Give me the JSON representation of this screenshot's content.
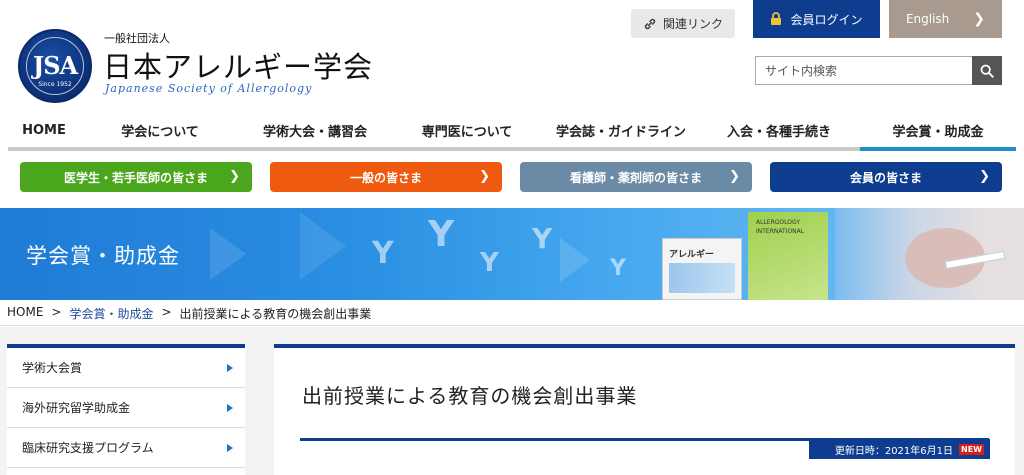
{
  "logo": {
    "emblem": "JSA",
    "since": "Since 1952",
    "org_type": "一般社団法人",
    "name_ja": "日本アレルギー学会",
    "name_en": "Japanese Society of Allergology"
  },
  "utility": {
    "links_label": "関連リンク",
    "login_label": "会員ログイン",
    "english_label": "English",
    "search_placeholder": "サイト内検索"
  },
  "nav": [
    {
      "label": "HOME",
      "active": false
    },
    {
      "label": "学会について",
      "active": false
    },
    {
      "label": "学術大会・講習会",
      "active": false
    },
    {
      "label": "専門医について",
      "active": false
    },
    {
      "label": "学会誌・ガイドライン",
      "active": false
    },
    {
      "label": "入会・各種手続き",
      "active": false
    },
    {
      "label": "学会賞・助成金",
      "active": true
    }
  ],
  "audience": [
    {
      "label": "医学生・若手医師の皆さま",
      "color": "#4aa61c"
    },
    {
      "label": "一般の皆さま",
      "color": "#ee5a10"
    },
    {
      "label": "看護師・薬剤師の皆さま",
      "color": "#6b8aa6"
    },
    {
      "label": "会員の皆さま",
      "color": "#0e3d8f"
    }
  ],
  "banner": {
    "title": "学会賞・助成金",
    "journal_ja": "アレルギー",
    "journal_en": "ALLERGOLOGY INTERNATIONAL"
  },
  "breadcrumb": {
    "home": "HOME",
    "section": "学会賞・助成金",
    "current": "出前授業による教育の機会創出事業",
    "sep": ">"
  },
  "sidebar": {
    "items": [
      {
        "label": "学術大会賞"
      },
      {
        "label": "海外研究留学助成金"
      },
      {
        "label": "臨床研究支援プログラム"
      }
    ]
  },
  "content": {
    "title": "出前授業による教育の機会創出事業",
    "updated": "更新日時：2021年6月1日",
    "new_badge": "NEW"
  },
  "colors": {
    "brand_navy": "#0e3d8f",
    "accent_blue": "#1d8fc9",
    "english_bg": "#a89a8e"
  }
}
